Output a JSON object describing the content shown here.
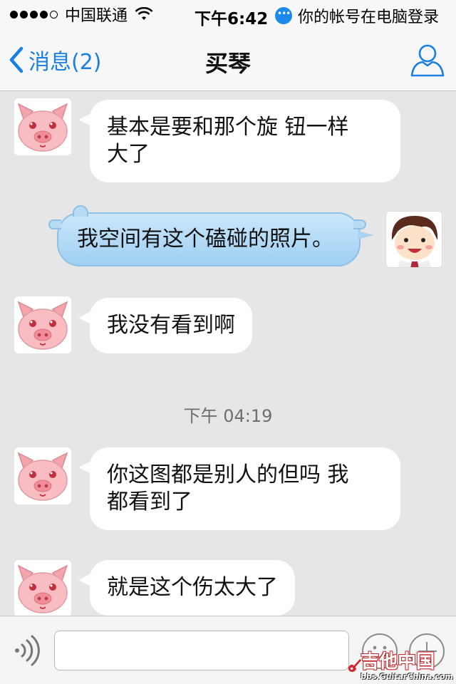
{
  "status_bar": {
    "carrier": "中国联通",
    "time": "下午6:42",
    "notice": "你的帐号在电脑登录"
  },
  "nav": {
    "back_label": "消息(2)",
    "title": "买琴"
  },
  "messages": [
    {
      "from": "pig",
      "text_lines": [
        "基本是要和那个旋 钮一样",
        "大了"
      ]
    },
    {
      "from": "me",
      "text": "我空间有这个磕碰的照片。"
    },
    {
      "from": "pig",
      "text_lines": [
        "我没有看到啊"
      ]
    },
    {
      "from": "pig",
      "text_lines": [
        "你这图都是别人的但吗 我",
        "都看到了"
      ]
    },
    {
      "from": "pig",
      "text_lines": [
        "就是这个伤太大了"
      ]
    }
  ],
  "timestamp": "下午 04:19",
  "input": {
    "value": "",
    "placeholder": ""
  },
  "watermark": {
    "main": "吉他中国",
    "sub": "bbs.GuitarChina.com"
  },
  "colors": {
    "accent": "#1a7fe2",
    "my_bubble": "#a8d3f2",
    "background": "#e6e6e6"
  }
}
